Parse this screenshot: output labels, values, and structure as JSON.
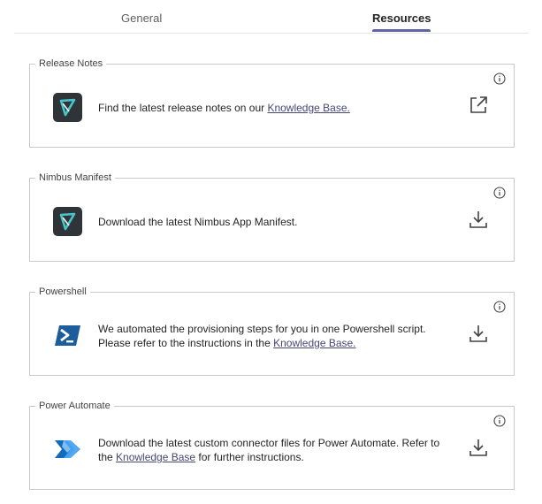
{
  "tabs": [
    {
      "label": "General",
      "active": false
    },
    {
      "label": "Resources",
      "active": true
    }
  ],
  "accent_color": "#6264a7",
  "cards": [
    {
      "legend": "Release Notes",
      "text_before": "Find the latest release notes on our ",
      "link": "Knowledge Base.",
      "text_after": "",
      "logo": "nimbus-logo-icon",
      "action": "external-link-icon"
    },
    {
      "legend": "Nimbus Manifest",
      "text_before": "Download the latest Nimbus App Manifest.",
      "logo": "nimbus-logo-icon",
      "action": "download-icon"
    },
    {
      "legend": "Powershell",
      "line1": "We automated the provisioning steps for you in one Powershell script.",
      "line2_before": "Please refer to the instructions in the ",
      "link": "Knowledge Base.",
      "logo": "powershell-icon",
      "action": "download-icon"
    },
    {
      "legend": "Power Automate",
      "line1": "Download the latest custom connector files for Power Automate. Refer to",
      "line2_before": "the ",
      "link": "Knowledge Base",
      "line2_after": " for further instructions.",
      "logo": "power-automate-icon",
      "action": "download-icon"
    }
  ]
}
